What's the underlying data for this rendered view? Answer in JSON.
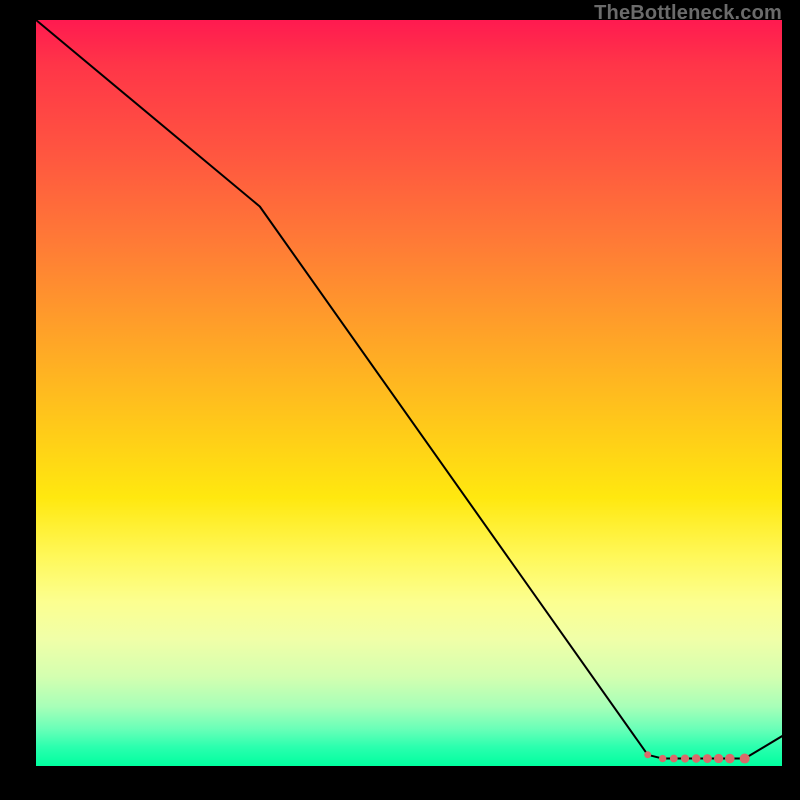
{
  "watermark": "TheBottleneck.com",
  "chart_data": {
    "type": "line",
    "title": "",
    "xlabel": "",
    "ylabel": "",
    "xlim": [
      0,
      100
    ],
    "ylim": [
      0,
      100
    ],
    "grid": false,
    "legend": false,
    "x": [
      0,
      30,
      82,
      84,
      95,
      100
    ],
    "y": [
      100,
      75,
      1.5,
      1,
      1,
      4
    ],
    "markers": {
      "x": [
        82,
        84,
        85.5,
        87,
        88.5,
        90,
        91.5,
        93,
        95
      ],
      "y": [
        1.5,
        1,
        1,
        1,
        1,
        1,
        1,
        1,
        1
      ],
      "color": "#d96a6a",
      "size_start": 7,
      "size_end": 10
    },
    "line": {
      "color": "#000000",
      "width": 2
    },
    "background": "rainbow-vertical-gradient"
  }
}
